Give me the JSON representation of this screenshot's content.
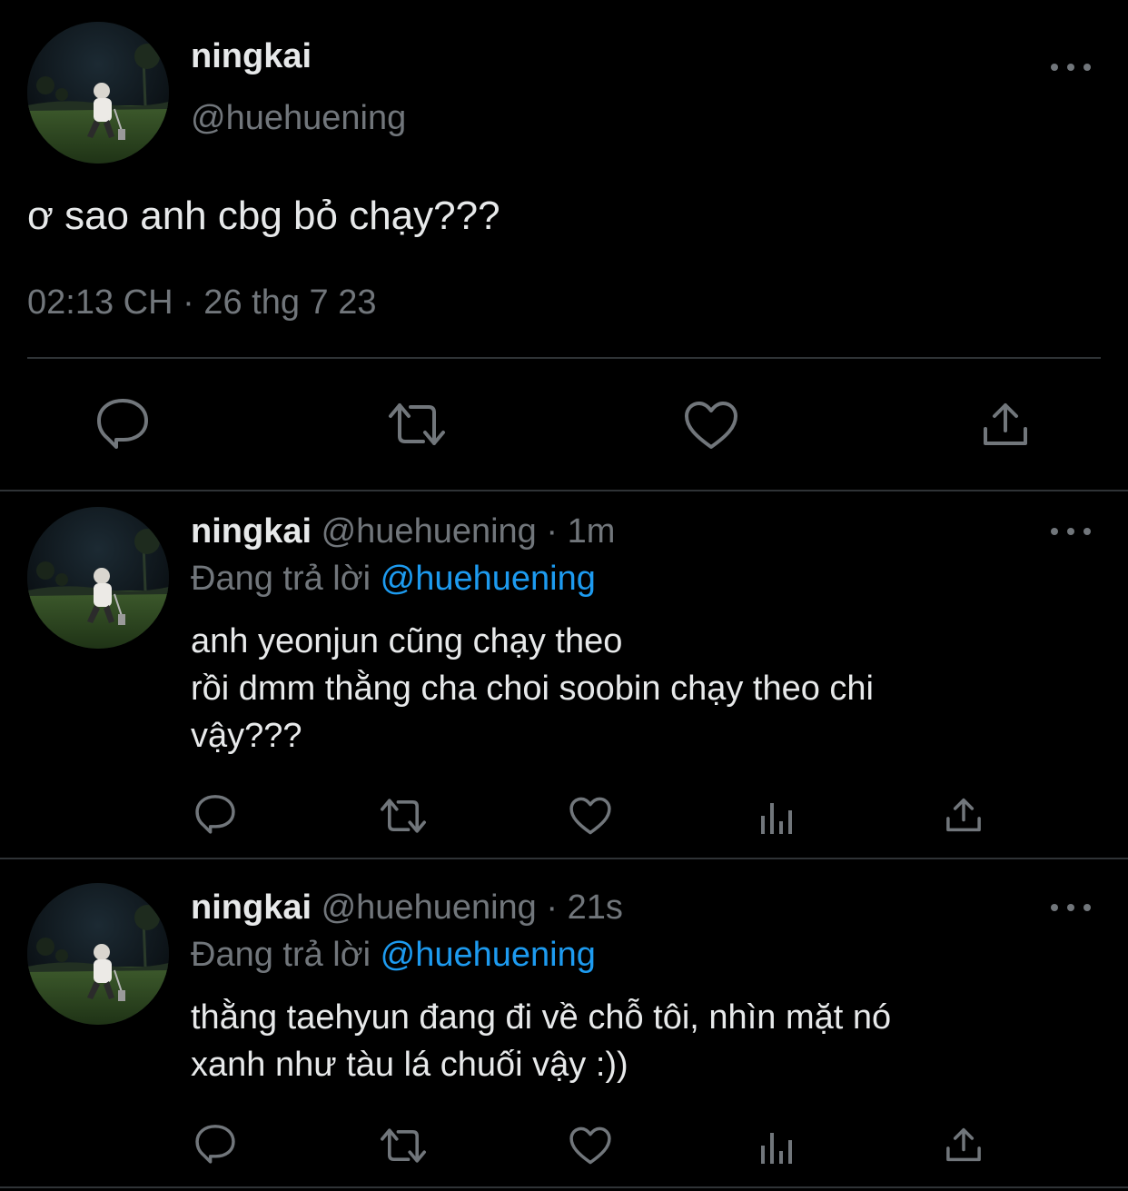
{
  "main_tweet": {
    "display_name": "ningkai",
    "handle": "@huehuening",
    "text": "ơ sao anh cbg bỏ chạy???",
    "timestamp": "02:13 CH · 26 thg 7 23",
    "avatar_icon": "avatar-photo",
    "actions": [
      "reply-icon",
      "retweet-icon",
      "like-icon",
      "share-icon"
    ]
  },
  "replies": [
    {
      "display_name": "ningkai",
      "handle": "@huehuening",
      "separator": "·",
      "time": "1m",
      "replying_label": "Đang trả lời",
      "replying_to": "@huehuening",
      "lines": [
        "anh yeonjun cũng chạy theo",
        "rồi dmm thằng cha choi soobin chạy theo chi",
        "vậy???"
      ]
    },
    {
      "display_name": "ningkai",
      "handle": "@huehuening",
      "separator": "·",
      "time": "21s",
      "replying_label": "Đang trả lời",
      "replying_to": "@huehuening",
      "lines": [
        "thằng taehyun đang đi về chỗ tôi, nhìn mặt nó",
        "xanh như tàu lá chuối vậy :))"
      ]
    }
  ],
  "colors": {
    "background": "#000000",
    "primary_text": "#e7e9ea",
    "secondary_text": "#71767b",
    "link": "#1d9bf0",
    "divider": "#2f3336"
  }
}
